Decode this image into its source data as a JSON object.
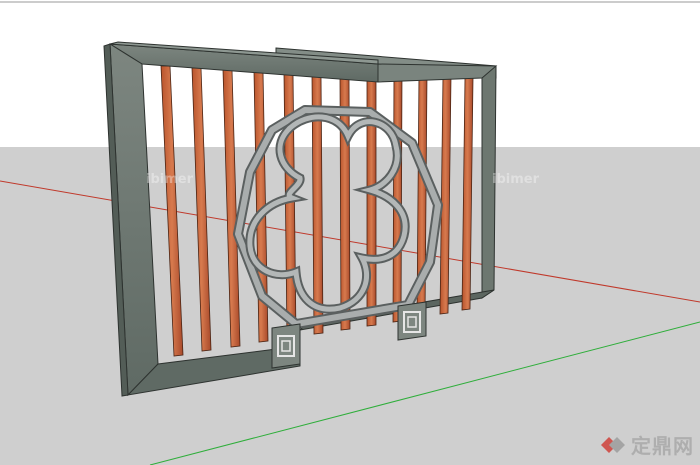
{
  "scene": {
    "sky_color": "#ffffff",
    "ground_color": "#cfcfcf",
    "red_axis_color": "#c0392b",
    "green_axis_color": "#2eae3a",
    "frame_color": "#6f7a73",
    "slat_color": "#c8663a",
    "ornament_color": "#8f9494"
  },
  "watermark": {
    "icon": "ding-logo-icon",
    "text": "定鼎网"
  },
  "faint_marks": {
    "left": "ibimer",
    "right": "ibimer"
  }
}
